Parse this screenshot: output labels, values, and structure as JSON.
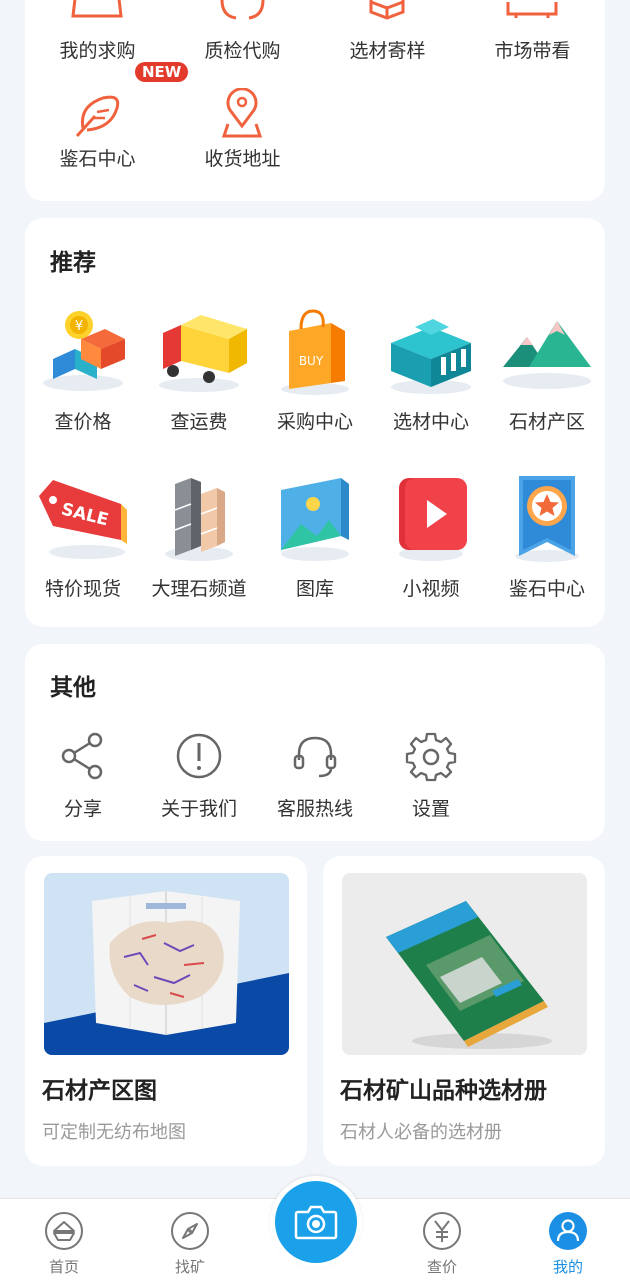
{
  "services": {
    "items": [
      {
        "label": "我的求购",
        "icon": "clipboard-icon"
      },
      {
        "label": "质检代购",
        "icon": "inspect-icon"
      },
      {
        "label": "选材寄样",
        "icon": "box-icon"
      },
      {
        "label": "市场带看",
        "icon": "car-icon"
      },
      {
        "label": "鉴石中心",
        "icon": "feather-icon",
        "badge": "NEW"
      },
      {
        "label": "收货地址",
        "icon": "location-pin-icon"
      }
    ]
  },
  "recommend": {
    "title": "推荐",
    "items": [
      {
        "label": "查价格",
        "icon": "price-coins-icon"
      },
      {
        "label": "查运费",
        "icon": "truck-icon"
      },
      {
        "label": "采购中心",
        "icon": "shopping-bag-icon"
      },
      {
        "label": "选材中心",
        "icon": "building-icon"
      },
      {
        "label": "石材产区",
        "icon": "mountain-icon"
      },
      {
        "label": "特价现货",
        "icon": "sale-tag-icon"
      },
      {
        "label": "大理石频道",
        "icon": "marble-blocks-icon"
      },
      {
        "label": "图库",
        "icon": "gallery-icon"
      },
      {
        "label": "小视频",
        "icon": "video-play-icon"
      },
      {
        "label": "鉴石中心",
        "icon": "star-badge-icon"
      }
    ],
    "bag_text": "BUY",
    "sale_text": "SALE"
  },
  "other": {
    "title": "其他",
    "items": [
      {
        "label": "分享",
        "icon": "share-icon"
      },
      {
        "label": "关于我们",
        "icon": "info-icon"
      },
      {
        "label": "客服热线",
        "icon": "headset-icon"
      },
      {
        "label": "设置",
        "icon": "gear-icon"
      }
    ]
  },
  "promos": [
    {
      "title": "石材产区图",
      "subtitle": "可定制无纺布地图",
      "image": "stone-map-image"
    },
    {
      "title": "石材矿山品种选材册",
      "subtitle": "石材人必备的选材册",
      "image": "catalog-book-image"
    }
  ],
  "tabbar": {
    "items": [
      {
        "label": "首页",
        "icon": "home-icon"
      },
      {
        "label": "找矿",
        "icon": "compass-icon"
      },
      {
        "label": "查价",
        "icon": "yen-icon"
      },
      {
        "label": "我的",
        "icon": "user-icon"
      }
    ],
    "camera_icon": "camera-icon",
    "active": "我的",
    "colors": {
      "accent": "#1a8fe3",
      "inactive": "#777777"
    }
  },
  "colors": {
    "service_icon": "#f0623e",
    "badge": "#e23b2c",
    "background": "#f2f5f9"
  }
}
